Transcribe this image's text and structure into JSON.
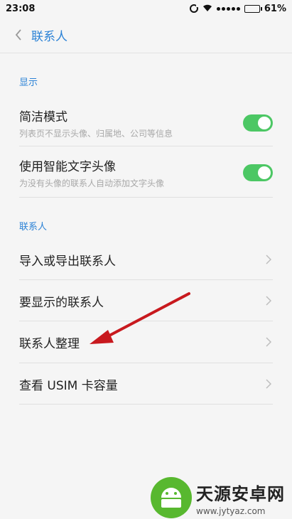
{
  "status_bar": {
    "time": "23:08",
    "battery": "61%",
    "battery_level": 0.61
  },
  "header": {
    "title": "联系人",
    "back_icon": "chevron-left-icon"
  },
  "sections": {
    "display": {
      "label": "显示",
      "items": [
        {
          "title": "简洁模式",
          "subtitle": "列表页不显示头像、归属地、公司等信息",
          "toggle_on": true
        },
        {
          "title": "使用智能文字头像",
          "subtitle": "为没有头像的联系人自动添加文字头像",
          "toggle_on": true
        }
      ]
    },
    "contacts": {
      "label": "联系人",
      "items": [
        {
          "title": "导入或导出联系人"
        },
        {
          "title": "要显示的联系人"
        },
        {
          "title": "联系人整理"
        },
        {
          "title": "查看 USIM 卡容量"
        }
      ]
    }
  },
  "colors": {
    "accent": "#2b82d6",
    "toggle_on": "#4cc764",
    "annotation_arrow": "#c8191e"
  },
  "watermark": {
    "name": "天源安卓网",
    "url": "www.jytyaz.com"
  }
}
